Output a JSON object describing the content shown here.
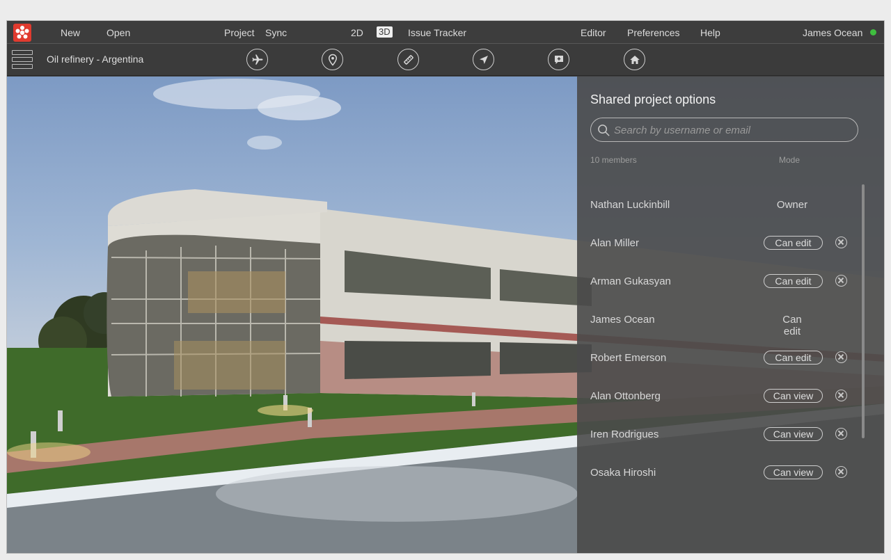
{
  "menubar": {
    "new": "New",
    "open": "Open",
    "project": "Project",
    "sync": "Sync",
    "view_2d": "2D",
    "view_3d": "3D",
    "issue_tracker": "Issue Tracker",
    "editor": "Editor",
    "preferences": "Preferences",
    "help": "Help",
    "user": "James Ocean",
    "status_color": "#3fbf3f"
  },
  "toolbar": {
    "project_title": "Oil refinery - Argentina",
    "tools": [
      "airplane-icon",
      "location-pin-icon",
      "ruler-icon",
      "navigation-arrow-icon",
      "add-comment-icon",
      "home-icon"
    ]
  },
  "panel": {
    "title": "Shared project options",
    "search_placeholder": "Search by username or email",
    "members_count": "10 members",
    "mode_header": "Mode",
    "members": [
      {
        "name": "Nathan Luckinbill",
        "mode": "Owner",
        "editable": false
      },
      {
        "name": "Alan Miller",
        "mode": "Can edit",
        "editable": true
      },
      {
        "name": "Arman Gukasyan",
        "mode": "Can edit",
        "editable": true
      },
      {
        "name": "James Ocean",
        "mode": "Can edit",
        "editable": false
      },
      {
        "name": "Robert Emerson",
        "mode": "Can edit",
        "editable": true
      },
      {
        "name": "Alan Ottonberg",
        "mode": "Can view",
        "editable": true
      },
      {
        "name": "Iren Rodrigues",
        "mode": "Can view",
        "editable": true
      },
      {
        "name": "Osaka Hiroshi",
        "mode": "Can view",
        "editable": true
      }
    ]
  },
  "colors": {
    "brand": "#e03b2f",
    "panel_bg": "#4a4a4a"
  }
}
